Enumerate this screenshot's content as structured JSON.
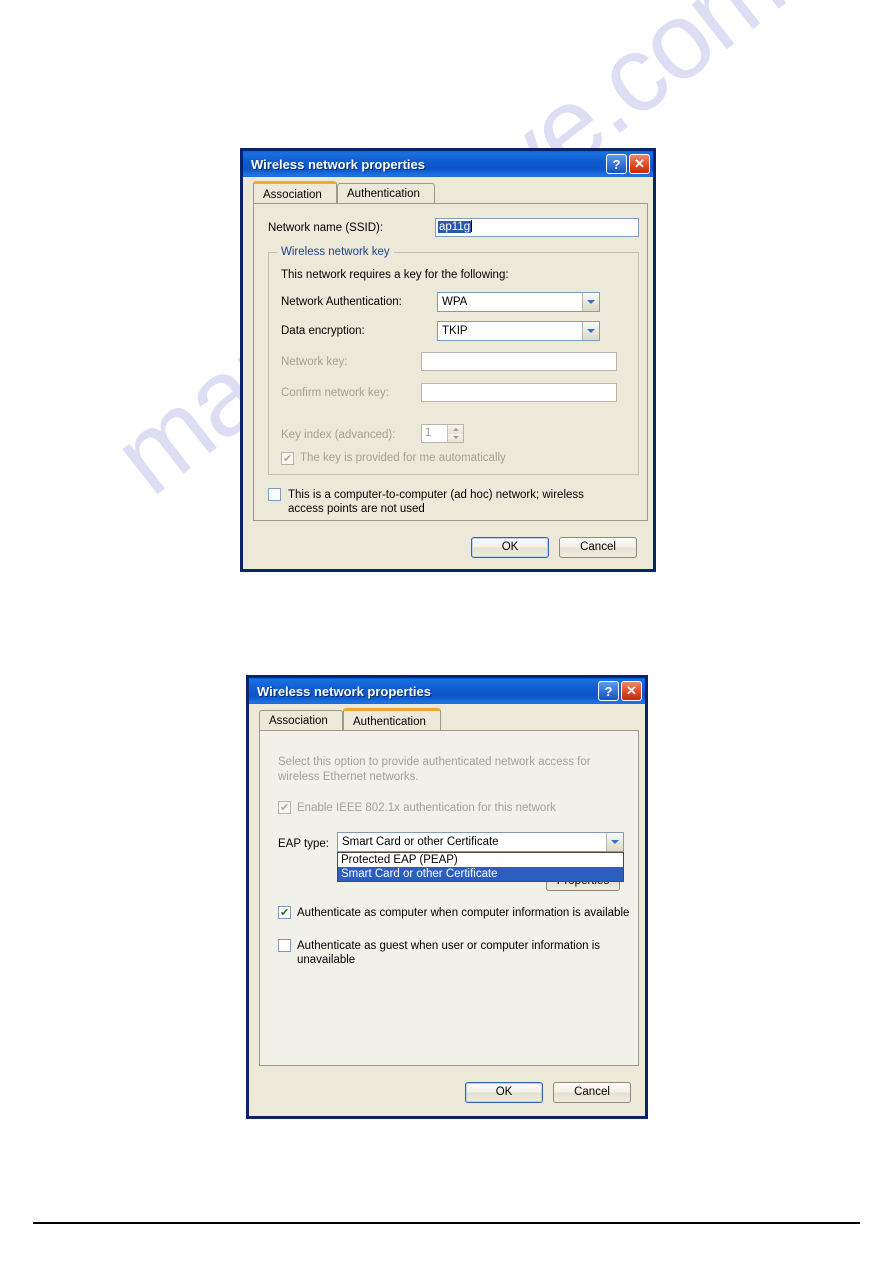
{
  "page": {
    "watermark": "manualshive.com"
  },
  "dialog1": {
    "title": "Wireless network properties",
    "help_button": "?",
    "close_button": "✕",
    "tabs": [
      {
        "label": "Association",
        "active": true
      },
      {
        "label": "Authentication",
        "active": false
      }
    ],
    "ssid_label": "Network name (SSID):",
    "ssid_value": "ap11g",
    "group_title": "Wireless network key",
    "group_intro": "This network requires a key for the following:",
    "auth_label": "Network Authentication:",
    "auth_value": "WPA",
    "encryption_label": "Data encryption:",
    "encryption_value": "TKIP",
    "network_key_label": "Network key:",
    "network_key_value": "",
    "confirm_key_label": "Confirm network key:",
    "confirm_key_value": "",
    "key_index_label": "Key index (advanced):",
    "key_index_value": "1",
    "key_auto_label": "The key is provided for me automatically",
    "adhoc_label_line1": "This is a computer-to-computer (ad hoc) network; wireless",
    "adhoc_label_line2": "access points are not used",
    "ok_label": "OK",
    "cancel_label": "Cancel"
  },
  "dialog2": {
    "title": "Wireless network properties",
    "help_button": "?",
    "close_button": "✕",
    "tabs": [
      {
        "label": "Association",
        "active": false
      },
      {
        "label": "Authentication",
        "active": true
      }
    ],
    "intro_line1": "Select this option to provide authenticated network access for",
    "intro_line2": "wireless Ethernet networks.",
    "enable_8021x_label": "Enable IEEE 802.1x authentication for this network",
    "eap_type_label": "EAP type:",
    "eap_type_value": "Smart Card or other Certificate",
    "eap_options": [
      {
        "label": "Protected EAP (PEAP)",
        "selected": false
      },
      {
        "label": "Smart Card or other Certificate",
        "selected": true
      }
    ],
    "properties_label": "Properties",
    "auth_computer_label": "Authenticate as computer when computer information is available",
    "auth_guest_line1": "Authenticate as guest when user or computer information is",
    "auth_guest_line2": "unavailable",
    "ok_label": "OK",
    "cancel_label": "Cancel"
  },
  "colors": {
    "titlebar_blue": "#0f5bd0",
    "dialog_face": "#ece9d8",
    "active_tab_accent": "#f0a830",
    "selection_blue": "#2a58b0",
    "group_title_blue": "#21438c",
    "watermark": "#c9c9ee"
  }
}
